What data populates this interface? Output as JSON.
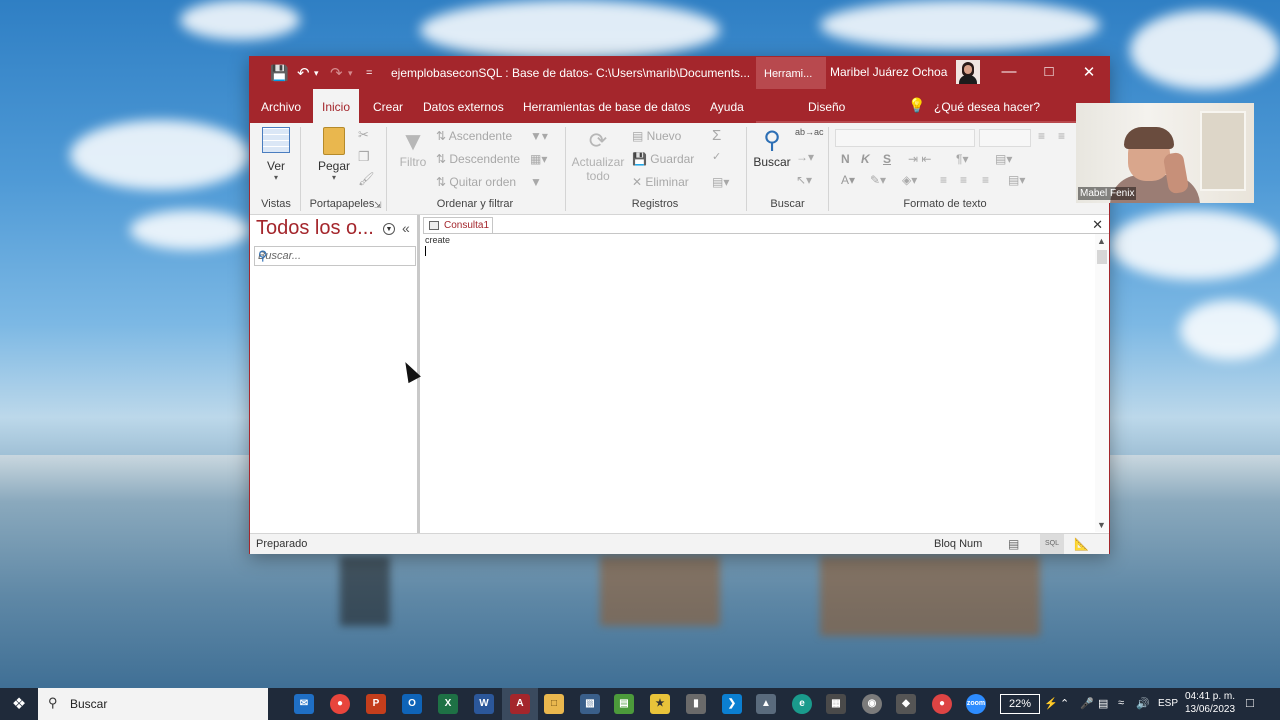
{
  "window": {
    "title": "ejemplobaseconSQL : Base de datos- C:\\Users\\marib\\Documents...",
    "context_tab_group": "Herrami...",
    "user_name": "Maribel Juárez Ochoa",
    "qat_customize": "="
  },
  "tabs": [
    {
      "label": "Archivo"
    },
    {
      "label": "Inicio"
    },
    {
      "label": "Crear"
    },
    {
      "label": "Datos externos"
    },
    {
      "label": "Herramientas de base de datos"
    },
    {
      "label": "Ayuda"
    },
    {
      "label": "Diseño"
    }
  ],
  "tell_me": "¿Qué desea hacer?",
  "ribbon": {
    "vistas": {
      "ver": "Ver",
      "label": "Vistas"
    },
    "portapapeles": {
      "pegar": "Pegar",
      "label": "Portapapeles"
    },
    "ordenar": {
      "filtro": "Filtro",
      "ascendente": "Ascendente",
      "descendente": "Descendente",
      "quitar_orden": "Quitar orden",
      "label": "Ordenar y filtrar"
    },
    "registros": {
      "actualizar": "Actualizar",
      "todo": "todo",
      "nuevo": "Nuevo",
      "guardar": "Guardar",
      "eliminar": "Eliminar",
      "label": "Registros"
    },
    "buscar": {
      "buscar": "Buscar",
      "label": "Buscar"
    },
    "formato": {
      "bold": "N",
      "italic": "K",
      "underline": "S",
      "font_color": "A",
      "label": "Formato de texto"
    }
  },
  "nav_pane": {
    "title": "Todos los o...",
    "collapse": "«",
    "search_placeholder": "Buscar..."
  },
  "document": {
    "tab_label": "Consulta1",
    "editor_text": "create"
  },
  "status": {
    "left": "Preparado",
    "bloq_num": "Bloq Num"
  },
  "webcam": {
    "name": "Mabel Fenix"
  },
  "taskbar": {
    "search_text": "Buscar",
    "battery": "22%",
    "language": "ESP",
    "time": "04:41 p. m.",
    "date": "13/06/2023"
  },
  "colors": {
    "accent": "#a4262c",
    "taskbar": "#1f2a3a"
  }
}
